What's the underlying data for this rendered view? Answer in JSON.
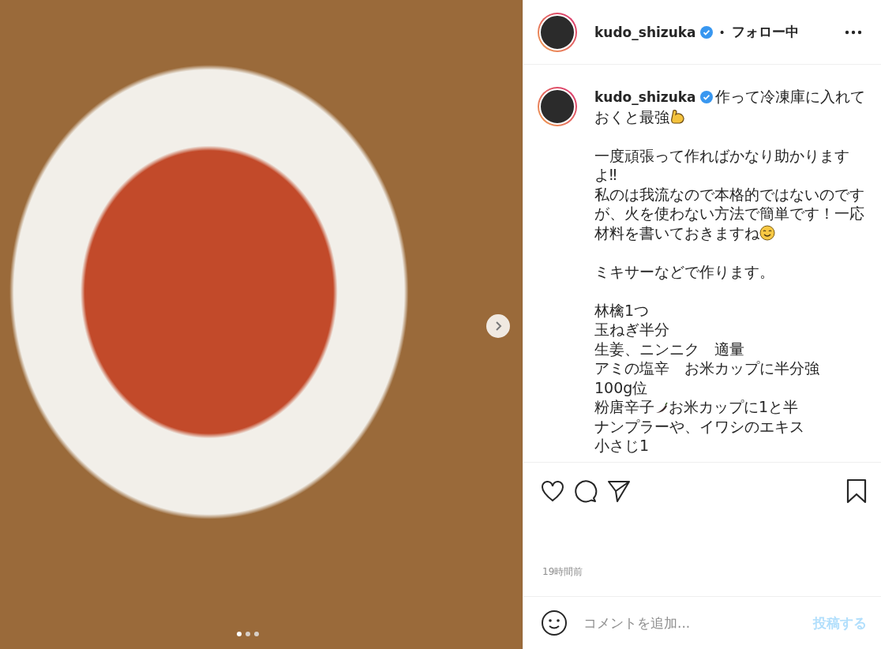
{
  "photo": {
    "dots": [
      {
        "selected": true
      },
      {
        "selected": false
      },
      {
        "selected": false
      }
    ]
  },
  "header": {
    "username": "kudo_shizuka",
    "verified": true,
    "separator": "•",
    "follow_status": "フォロー中"
  },
  "caption": {
    "username": "kudo_shizuka",
    "verified": true,
    "paragraphs": [
      [
        [
          {
            "kind": "text",
            "text": "作って冷凍庫に入れて"
          }
        ],
        [
          {
            "kind": "text",
            "text": "おくと最強"
          },
          {
            "kind": "flex"
          }
        ]
      ],
      [
        [
          {
            "kind": "text",
            "text": "一度頑張って作ればかなり助かります"
          }
        ],
        [
          {
            "kind": "text",
            "text": "よ‼"
          }
        ],
        [
          {
            "kind": "text",
            "text": "私のは我流なので本格的ではないのです"
          }
        ],
        [
          {
            "kind": "text",
            "text": "が、火を使わない方法で簡単です！一応"
          }
        ],
        [
          {
            "kind": "text",
            "text": "材料を書いておきますね"
          },
          {
            "kind": "smile"
          }
        ]
      ],
      [
        [
          {
            "kind": "text",
            "text": "ミキサーなどで作ります。"
          }
        ]
      ],
      [
        [
          {
            "kind": "text",
            "text": "林檎1つ"
          }
        ],
        [
          {
            "kind": "text",
            "text": "玉ねぎ半分"
          }
        ],
        [
          {
            "kind": "text",
            "text": "生姜、ニンニク　適量"
          }
        ],
        [
          {
            "kind": "text",
            "text": "アミの塩辛　お米カップに半分強"
          }
        ],
        [
          {
            "kind": "text",
            "text": "100g位"
          }
        ],
        [
          {
            "kind": "text",
            "text": "粉唐辛子"
          },
          {
            "kind": "chili"
          },
          {
            "kind": "text",
            "text": "お米カップに1と半"
          }
        ],
        [
          {
            "kind": "text",
            "text": "ナンプラーや、イワシのエキス"
          }
        ],
        [
          {
            "kind": "text",
            "text": "小さじ1"
          }
        ]
      ]
    ]
  },
  "time": "19時間前",
  "comment": {
    "placeholder": "コメントを追加...",
    "post_button": "投稿する"
  }
}
